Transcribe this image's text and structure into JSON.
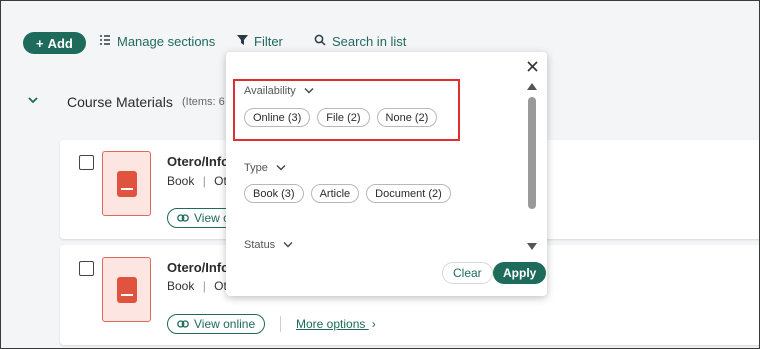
{
  "toolbar": {
    "add_label": "Add",
    "manage_sections_label": "Manage sections",
    "filter_label": "Filter",
    "search_label": "Search in list"
  },
  "section": {
    "title": "Course Materials",
    "count_partial": "(Items: 6"
  },
  "cards": [
    {
      "title": "Otero/Info",
      "meta_type": "Book",
      "meta_rest": "Ot",
      "view_online": "View o"
    },
    {
      "title": "Otero/Info",
      "meta_type": "Book",
      "meta_rest": "Ot",
      "view_online": "View online",
      "more_options": "More options"
    }
  ],
  "filter_popover": {
    "availability": {
      "label": "Availability",
      "options": [
        "Online (3)",
        "File (2)",
        "None (2)"
      ]
    },
    "type": {
      "label": "Type",
      "options": [
        "Book (3)",
        "Article",
        "Document (2)"
      ]
    },
    "status": {
      "label": "Status"
    },
    "clear_label": "Clear",
    "apply_label": "Apply"
  },
  "colors": {
    "accent": "#1e6b5c",
    "highlight": "#e0302e",
    "thumbnail": "#e0533f"
  },
  "icons": {
    "close": "close-icon",
    "filter": "filter-icon",
    "search": "search-icon",
    "manage": "manage-sections-icon",
    "link": "link-icon"
  }
}
